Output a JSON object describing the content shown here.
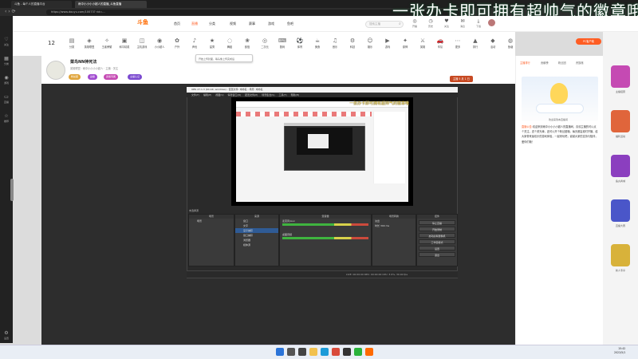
{
  "browser": {
    "tabs": [
      {
        "title": "斗鱼 - 每个人的直播平台"
      },
      {
        "title": "雨中小小小小超人的直播_斗鱼直播"
      }
    ],
    "url": "https://www.douyu.com/10073? rid=..."
  },
  "overlay": {
    "title": "一张办卡即可拥有超帅气的徽章哦"
  },
  "sidebar": {
    "items": [
      {
        "label": "关注",
        "icon": "heart-icon"
      },
      {
        "label": "分类",
        "icon": "grid-icon"
      },
      {
        "label": "游戏",
        "icon": "gamepad-icon"
      },
      {
        "label": "直播",
        "icon": "tv-icon"
      },
      {
        "label": "推荐",
        "icon": "star-icon"
      }
    ],
    "footer": "设置"
  },
  "header": {
    "logo": "斗鱼",
    "nav": [
      "首页",
      "直播",
      "分类",
      "视频",
      "赛事",
      "游戏",
      "鱼吧"
    ],
    "search_placeholder": "搜索主播",
    "icons": [
      {
        "label": "开播",
        "icon": "broadcast-icon"
      },
      {
        "label": "历史",
        "icon": "history-icon"
      },
      {
        "label": "关注",
        "icon": "follow-icon"
      },
      {
        "label": "消息",
        "icon": "message-icon"
      },
      {
        "label": "下载",
        "icon": "download-icon"
      },
      {
        "label": "皮肤",
        "icon": "skin-icon"
      }
    ]
  },
  "catbar": {
    "count": "12",
    "items": [
      "分类",
      "英雄联盟",
      "王者荣耀",
      "和平精英",
      "主机游戏",
      "小小超人",
      "户外",
      "声优",
      "星秀",
      "舞蹈",
      "颜值",
      "二次元",
      "数码",
      "体育",
      "美食",
      "音乐",
      "科技",
      "娱乐",
      "游戏",
      "原神",
      "英雄",
      "车队",
      "更多",
      "排行",
      "活动",
      "鱼塘"
    ]
  },
  "room": {
    "title": "菜鸟NN神死法",
    "sub": "英雄联盟 · 雨中小小小小超人 · 主播 · 关注",
    "tags": [
      "粉丝团",
      "勋章",
      "贵族专属",
      "主播认证"
    ],
    "report": "主播 5 月 1 日",
    "pc_btn": "PC客户端"
  },
  "tooltip": "开始上传封面，等头像上传完成后",
  "obs": {
    "title": "OBS 27.1.3 (64-bit, windows) - 配置文件: 未命名 - 场景: 未命名",
    "menu": [
      "文件(F)",
      "编辑(E)",
      "视图(V)",
      "停靠窗口(D)",
      "配置文件(P)",
      "场景集合(S)",
      "工具(T)",
      "帮助(H)"
    ],
    "inner_banner": "一张办卡即可拥有超帅气的徽章哦",
    "scene_label": "未选择源",
    "panels": {
      "scenes": {
        "title": "场景",
        "items": [
          "场景"
        ]
      },
      "sources": {
        "title": "来源",
        "items": [
          "窗口",
          "文字",
          "显示捕获",
          "窗口捕获",
          "浏览器",
          "媒体源"
        ]
      },
      "mixer": {
        "title": "混音器",
        "items": [
          "麦克风/Aux",
          "桌面音频"
        ]
      },
      "transitions": {
        "title": "场景转换",
        "items": [
          "淡出",
          "时长 300 ms"
        ]
      },
      "controls": {
        "title": "控件",
        "items": [
          "停止直播",
          "开始录制",
          "启动虚拟摄像机",
          "工作室模式",
          "设置",
          "退出"
        ]
      }
    },
    "status": "LIVE: 00:00:00   REC: 00:00:00   CPU: 3.9%, 30.00 fps"
  },
  "rightpanel": {
    "tabs": [
      "主播排行",
      "贡献榜",
      "粉丝团",
      "贵族席"
    ],
    "banner_text": "欢迎来到本直播间",
    "notice_tag": "直播公告:",
    "notice_body": "欢迎来到雨中小小小小超人的直播间，喜欢主播的可以点个关注，送个荧光棒，还可以开个粉丝团哦。每天都会准时开播，给大家带来最欢乐的游戏体验，一起来玩吧，谢谢大家的支持与陪伴，爱你们哦！"
  },
  "ads": [
    {
      "label": "主播招募",
      "color": "#c54ab3"
    },
    {
      "label": "福利活动",
      "color": "#e0653b"
    },
    {
      "label": "鱼丸商城",
      "color": "#8b3fbf"
    },
    {
      "label": "直播大赛",
      "color": "#4a56c9"
    },
    {
      "label": "新人专享",
      "color": "#d8b23a"
    }
  ],
  "taskbar": {
    "time": "15:42",
    "date": "2022/5/1",
    "icons": [
      {
        "name": "windows-start-icon",
        "color": "#2b74d8"
      },
      {
        "name": "search-icon",
        "color": "#555"
      },
      {
        "name": "taskview-icon",
        "color": "#444"
      },
      {
        "name": "explorer-icon",
        "color": "#f2c14e"
      },
      {
        "name": "edge-icon",
        "color": "#1c9bd8"
      },
      {
        "name": "chrome-icon",
        "color": "#d94b3b"
      },
      {
        "name": "obs-icon",
        "color": "#333"
      },
      {
        "name": "wechat-icon",
        "color": "#2ab33b"
      },
      {
        "name": "douyu-icon",
        "color": "#ff6a00"
      }
    ]
  }
}
